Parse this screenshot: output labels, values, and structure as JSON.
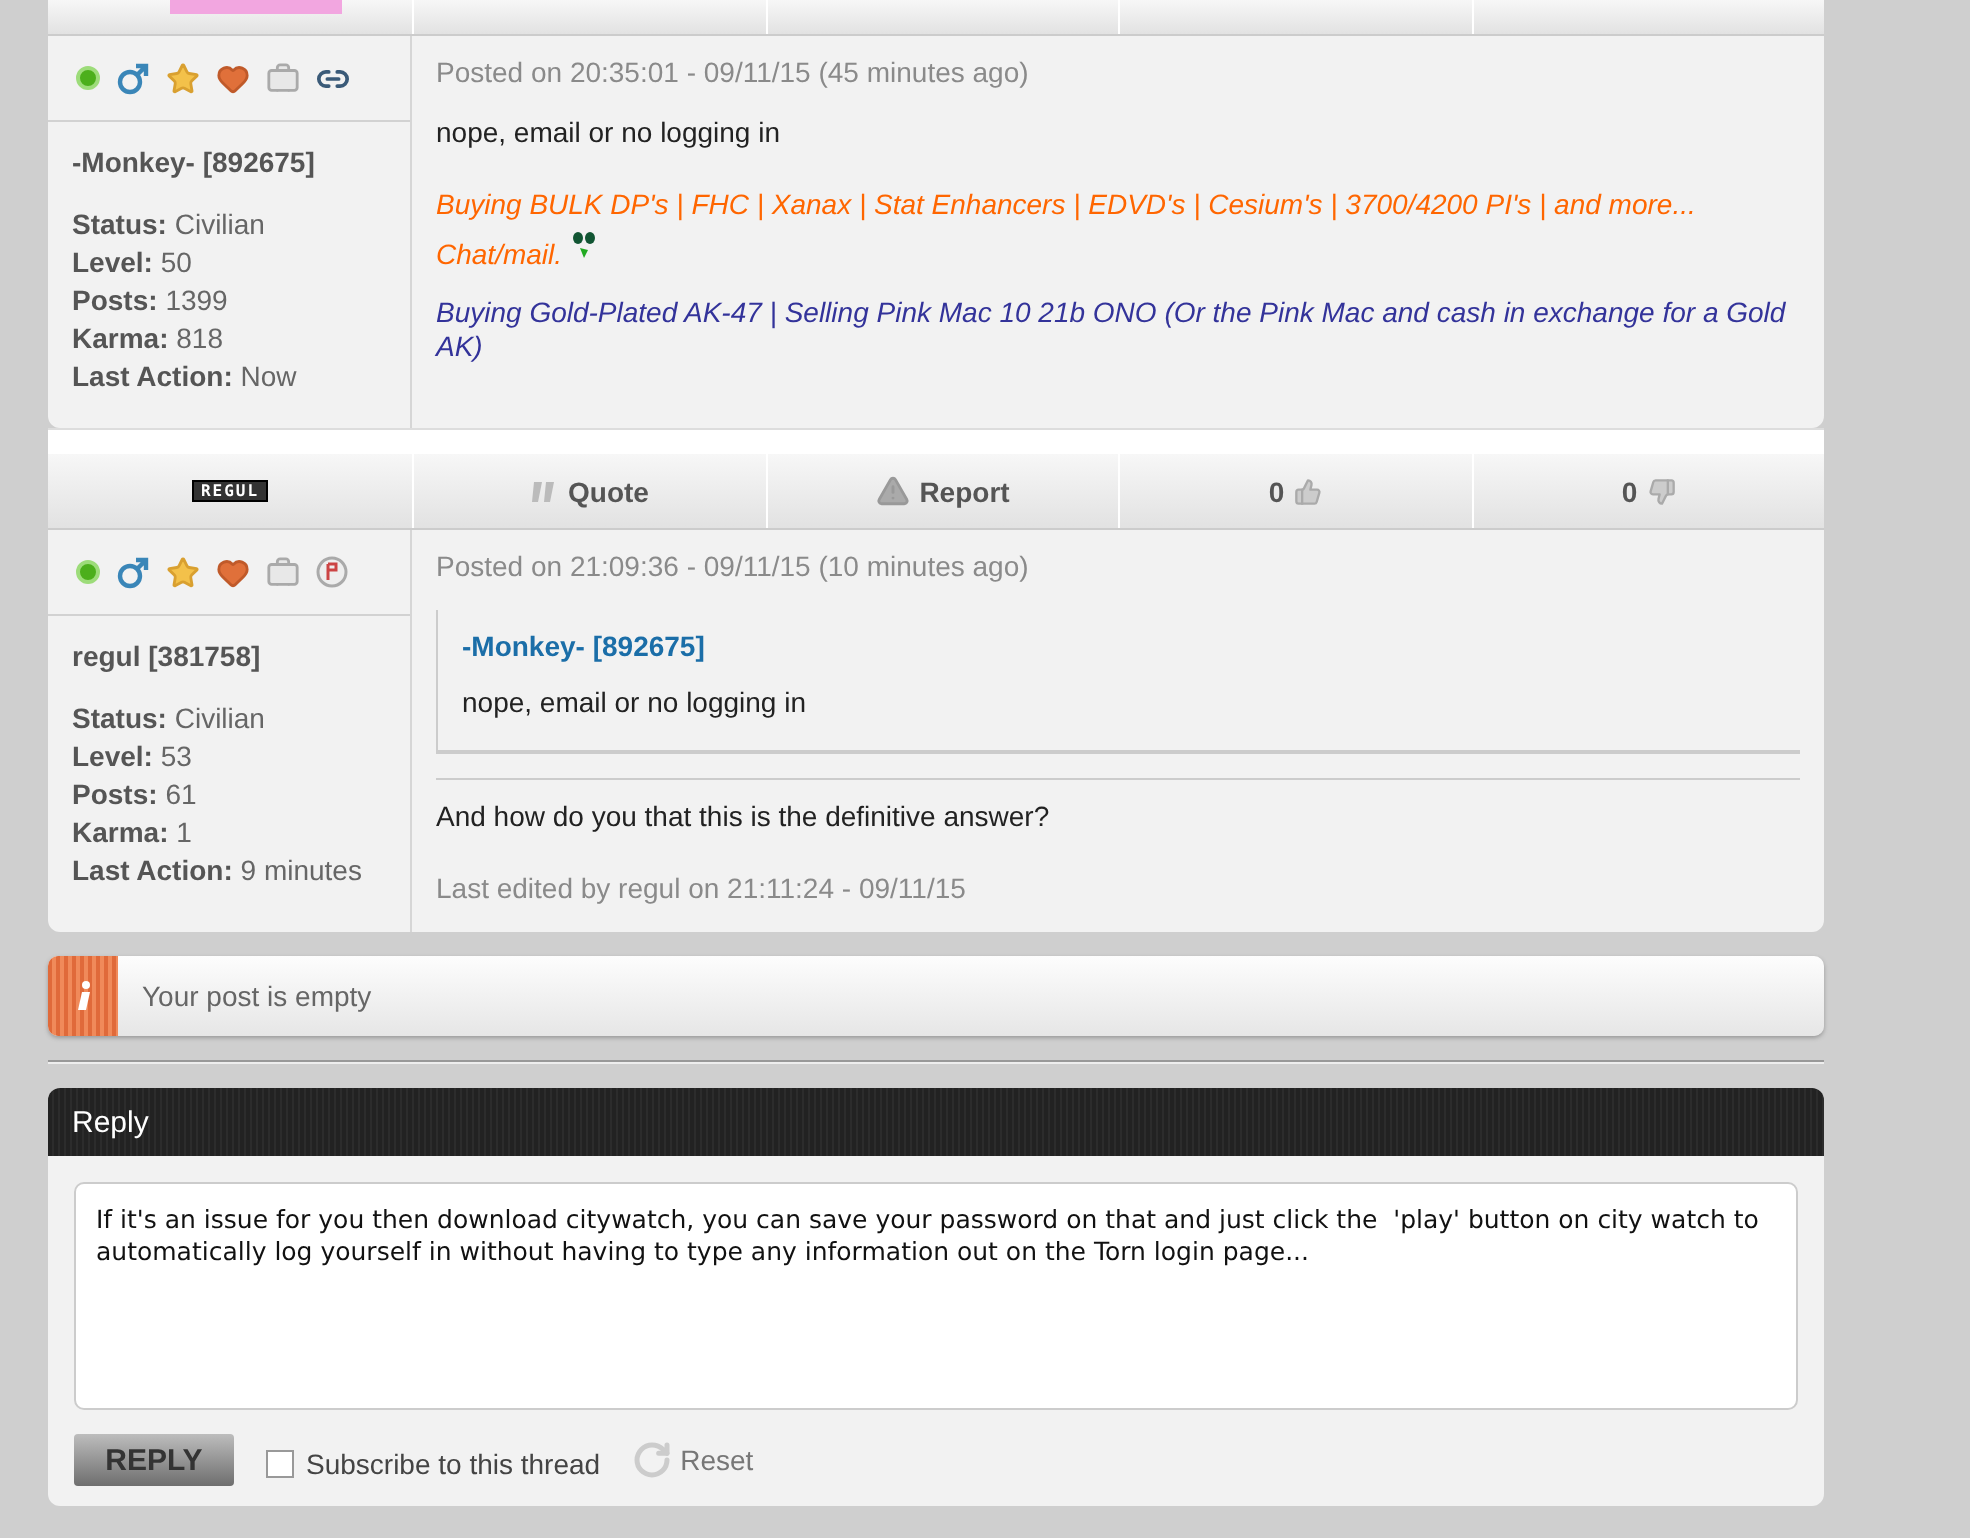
{
  "posts": [
    {
      "avatar": {
        "kind": "image"
      },
      "user": {
        "name": "-Monkey- [892675]",
        "icons": [
          {
            "kind": "online"
          },
          {
            "kind": "male"
          },
          {
            "kind": "star"
          },
          {
            "kind": "heart"
          },
          {
            "kind": "briefcase"
          },
          {
            "kind": "link"
          }
        ],
        "stats": [
          {
            "label": "Status:",
            "value": "Civilian"
          },
          {
            "label": "Level:",
            "value": "50"
          },
          {
            "label": "Posts:",
            "value": "1399"
          },
          {
            "label": "Karma:",
            "value": "818"
          },
          {
            "label": "Last Action:",
            "value": "Now"
          }
        ]
      },
      "posted": "Posted on 20:35:01 - 09/11/15 (45 minutes ago)",
      "message": "nope, email or no logging in",
      "signature": [
        {
          "text": "Buying BULK DP's | FHC | Xanax | Stat Enhancers | EDVD's | Cesium's | 3700/4200 PI's | and more... Chat/mail.",
          "color": "#ff6600",
          "emoji": true
        },
        {
          "text": "Buying Gold-Plated AK-47 | Selling Pink Mac 10 21b ONO (Or the Pink Mac and cash in exchange for a Gold AK)",
          "color": "#33339a"
        }
      ]
    },
    {
      "avatar": {
        "kind": "text",
        "text": "REGUL"
      },
      "toolbar": {
        "quote": "Quote",
        "report": "Report",
        "likes": "0",
        "dislikes": "0"
      },
      "user": {
        "name": "regul [381758]",
        "icons": [
          {
            "kind": "online"
          },
          {
            "kind": "male"
          },
          {
            "kind": "star"
          },
          {
            "kind": "heart"
          },
          {
            "kind": "briefcase"
          },
          {
            "kind": "badge"
          }
        ],
        "stats": [
          {
            "label": "Status:",
            "value": "Civilian"
          },
          {
            "label": "Level:",
            "value": "53"
          },
          {
            "label": "Posts:",
            "value": "61"
          },
          {
            "label": "Karma:",
            "value": "1"
          },
          {
            "label": "Last Action:",
            "value": "9 minutes"
          }
        ]
      },
      "posted": "Posted on 21:09:36 - 09/11/15 (10 minutes ago)",
      "quote": {
        "author": "-Monkey- [892675]",
        "text": "nope, email or no logging in"
      },
      "message": "And how do you that this is the definitive answer?",
      "edited": "Last edited by regul on 21:11:24 - 09/11/15"
    }
  ],
  "notice": {
    "text": "Your post is empty"
  },
  "reply": {
    "title": "Reply",
    "value": "If it's an issue for you then download citywatch, you can save your password on that and just click the  'play' button on city watch to automatically log yourself in without having to type any information out on the Torn login page...",
    "button": "REPLY",
    "subscribe": {
      "label": "Subscribe to this thread",
      "checked": false
    },
    "reset": "Reset"
  }
}
